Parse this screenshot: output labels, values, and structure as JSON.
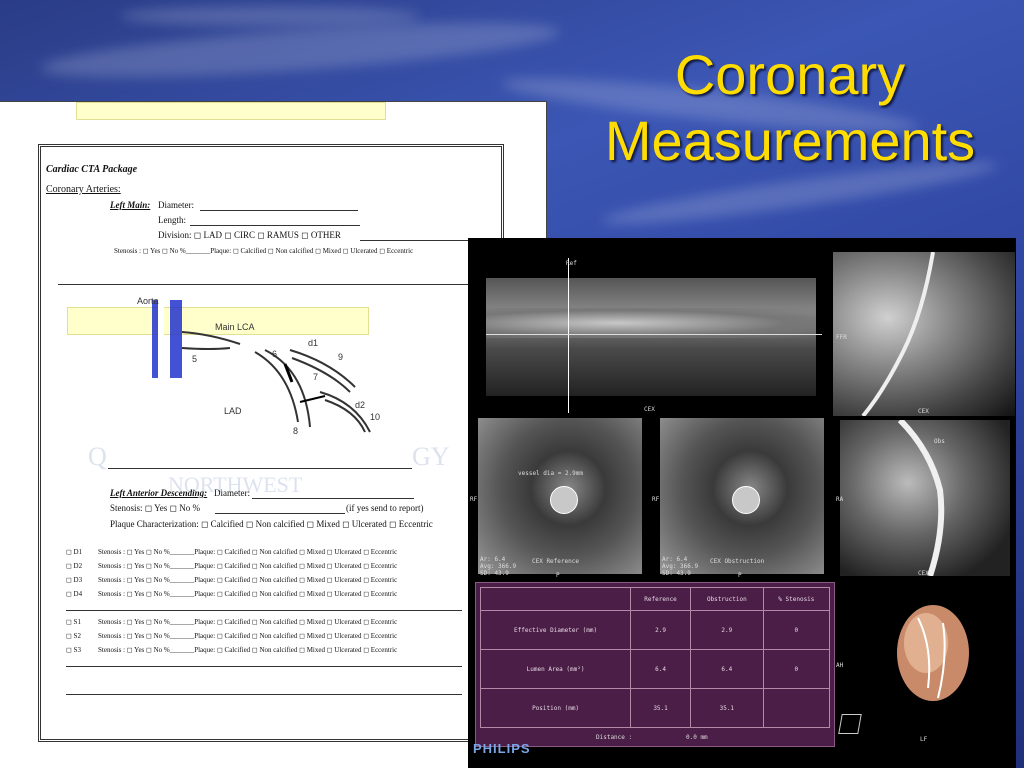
{
  "slide": {
    "title_line1": "Coronary",
    "title_line2": "Measurements"
  },
  "form": {
    "header": "Cardiac CTA Package",
    "section": "Coronary Arteries:",
    "left_main": {
      "label": "Left Main:",
      "diameter": "Diameter:",
      "length": "Length:",
      "division": "Division:  ◻ LAD   ◻ CIRC   ◻ RAMUS ◻  OTHER",
      "stenosis": "Stenosis :   ◻ Yes   ◻ No   %_______Plaque: ◻ Calcified  ◻ Non calcified  ◻ Mixed  ◻ Ulcerated  ◻ Eccentric"
    },
    "diagram_labels": {
      "aorta": "Aorta",
      "main_lca": "Main LCA",
      "lad": "LAD",
      "n5": "5",
      "n6": "6",
      "n7": "7",
      "n8": "8",
      "n9": "9",
      "n10": "10",
      "d1": "d1",
      "d2": "d2"
    },
    "watermark": {
      "left": "Q",
      "right": "GY",
      "center": "NORTHWEST"
    },
    "lad": {
      "label": "Left Anterior Descending:",
      "diameter": "Diameter:",
      "stenosis": "Stenosis:   ◻ Yes   ◻ No   %",
      "report": "(if yes send to report)",
      "plaque": "Plaque Characterization:  ◻ Calcified  ◻ Non calcified  ◻ Mixed  ◻ Ulcerated  ◻  Eccentric"
    },
    "rows": [
      {
        "name": "◻ D1",
        "text": "Stenosis :   ◻ Yes   ◻ No   %_______Plaque:  ◻ Calcified  ◻ Non calcified  ◻ Mixed  ◻ Ulcerated  ◻  Eccentric"
      },
      {
        "name": "◻ D2",
        "text": "Stenosis :   ◻ Yes   ◻ No   %_______Plaque:  ◻ Calcified  ◻ Non calcified  ◻ Mixed  ◻ Ulcerated  ◻  Eccentric"
      },
      {
        "name": "◻ D3",
        "text": "Stenosis :   ◻ Yes   ◻ No   %_______Plaque:  ◻ Calcified  ◻ Non calcified  ◻ Mixed  ◻ Ulcerated  ◻  Eccentric"
      },
      {
        "name": "◻ D4",
        "text": "Stenosis :   ◻ Yes   ◻ No   %_______Plaque:  ◻ Calcified  ◻ Non calcified  ◻ Mixed  ◻ Ulcerated  ◻  Eccentric"
      },
      {
        "name": "◻ S1",
        "text": "Stenosis :   ◻ Yes   ◻ No   %_______Plaque:  ◻ Calcified  ◻ Non calcified  ◻ Mixed  ◻ Ulcerated  ◻  Eccentric"
      },
      {
        "name": "◻ S2",
        "text": "Stenosis :   ◻ Yes   ◻ No   %_______Plaque:  ◻ Calcified  ◻ Non calcified  ◻ Mixed  ◻ Ulcerated  ◻  Eccentric"
      },
      {
        "name": "◻ S3",
        "text": "Stenosis :   ◻ Yes   ◻ No   %_______Plaque:  ◻ Calcified  ◻ Non calcified  ◻ Mixed  ◻ Ulcerated  ◻  Eccentric"
      }
    ]
  },
  "ct": {
    "labels": {
      "top_marker": "Ref",
      "ffr": "FFR",
      "cex1": "CEX",
      "cex2": "CEX",
      "cex3": "CEX",
      "obs": "Obs",
      "rf1": "RF",
      "rf2": "RF",
      "ra": "RA",
      "ah": "AH",
      "lf": "LF",
      "p1": "P",
      "p2": "P",
      "vessel_dia": "vessel dia = 2.9mm",
      "cex_ref": "CEX Reference",
      "cex_obs": "CEX Obstruction",
      "stats1": "Ar: 6.4\nAvg: 366.9\nSD: 43.9",
      "stats2": "Ar: 6.4\nAvg: 366.9\nSD: 43.9"
    },
    "table": {
      "headers": [
        "",
        "Reference",
        "Obstruction",
        "% Stenosis"
      ],
      "rows": [
        [
          "Effective Diameter (mm)",
          "2.9",
          "2.9",
          "0"
        ],
        [
          "Lumen Area (mm²)",
          "6.4",
          "6.4",
          "0"
        ],
        [
          "Position (mm)",
          "35.1",
          "35.1",
          ""
        ]
      ],
      "distance_label": "Distance :",
      "distance_value": "0.0 mm"
    },
    "brand": "PHILIPS"
  }
}
